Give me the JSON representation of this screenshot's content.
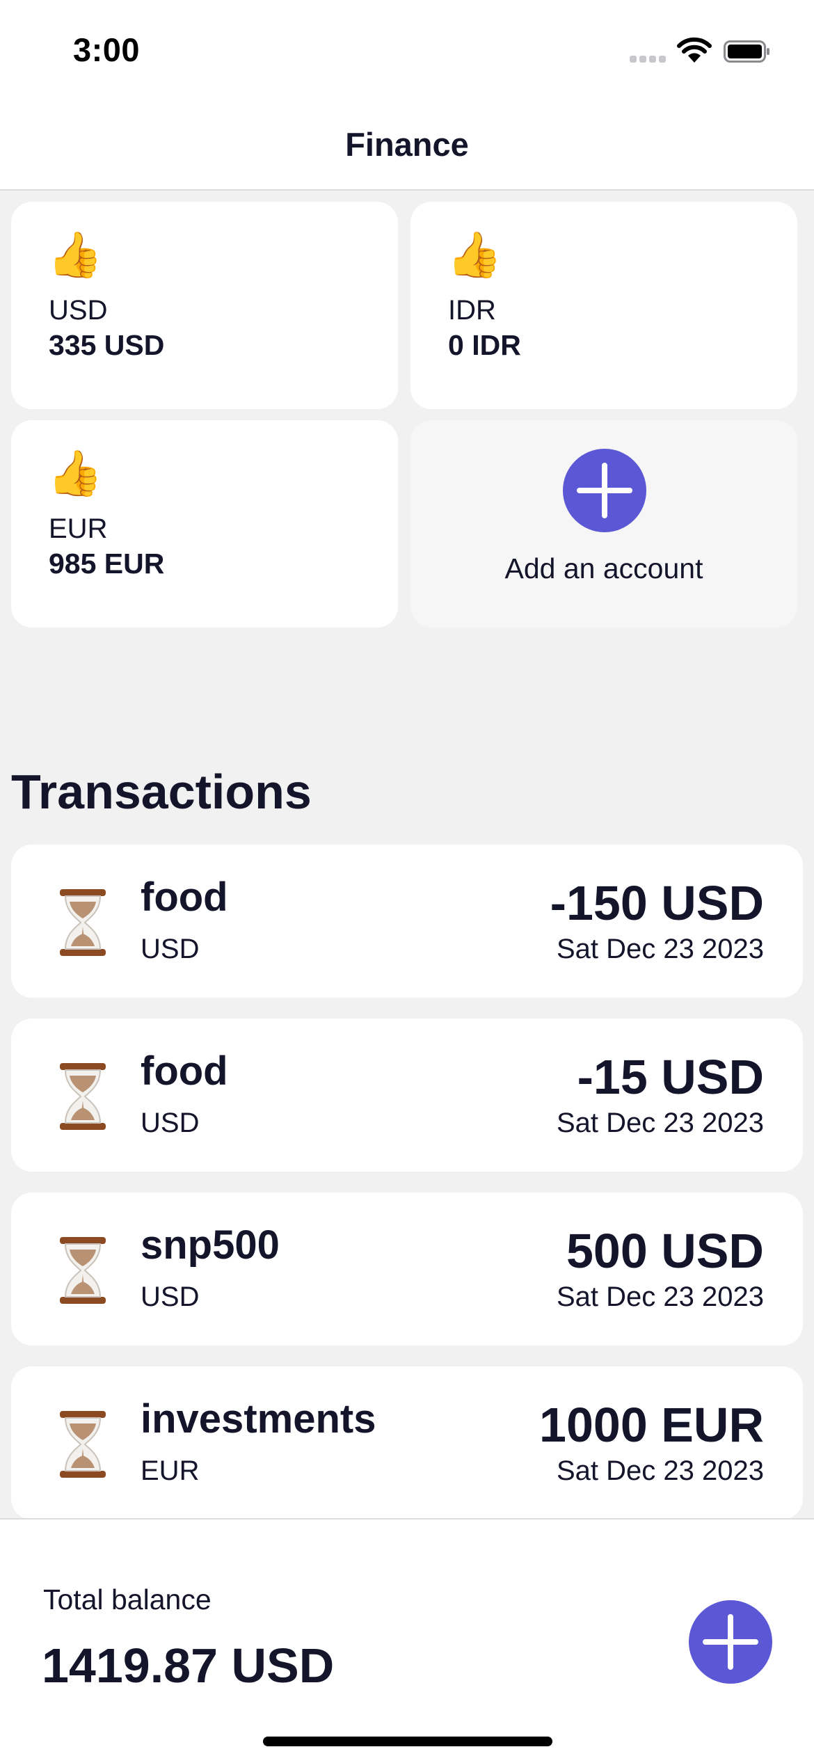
{
  "status_bar": {
    "time": "3:00"
  },
  "nav": {
    "title": "Finance"
  },
  "accounts": [
    {
      "emoji": "👍",
      "name": "USD",
      "balance": "335 USD"
    },
    {
      "emoji": "👍",
      "name": "IDR",
      "balance": "0 IDR"
    },
    {
      "emoji": "👍",
      "name": "EUR",
      "balance": "985 EUR"
    }
  ],
  "add_account": {
    "label": "Add an account"
  },
  "transactions_section": {
    "title": "Transactions",
    "items": [
      {
        "title": "food",
        "currency": "USD",
        "amount": "-150 USD",
        "date": "Sat Dec 23 2023"
      },
      {
        "title": "food",
        "currency": "USD",
        "amount": "-15 USD",
        "date": "Sat Dec 23 2023"
      },
      {
        "title": "snp500",
        "currency": "USD",
        "amount": "500 USD",
        "date": "Sat Dec 23 2023"
      },
      {
        "title": "investments",
        "currency": "EUR",
        "amount": "1000 EUR",
        "date": "Sat Dec 23 2023"
      }
    ]
  },
  "footer": {
    "total_label": "Total balance",
    "total_value": "1419.87 USD"
  },
  "colors": {
    "accent": "#5b57d5",
    "background": "#f1f1f1",
    "card": "#ffffff",
    "text": "#14142b"
  },
  "icons": {
    "account": "thumbs-up-icon",
    "transaction": "hourglass-icon",
    "add": "plus-icon"
  }
}
